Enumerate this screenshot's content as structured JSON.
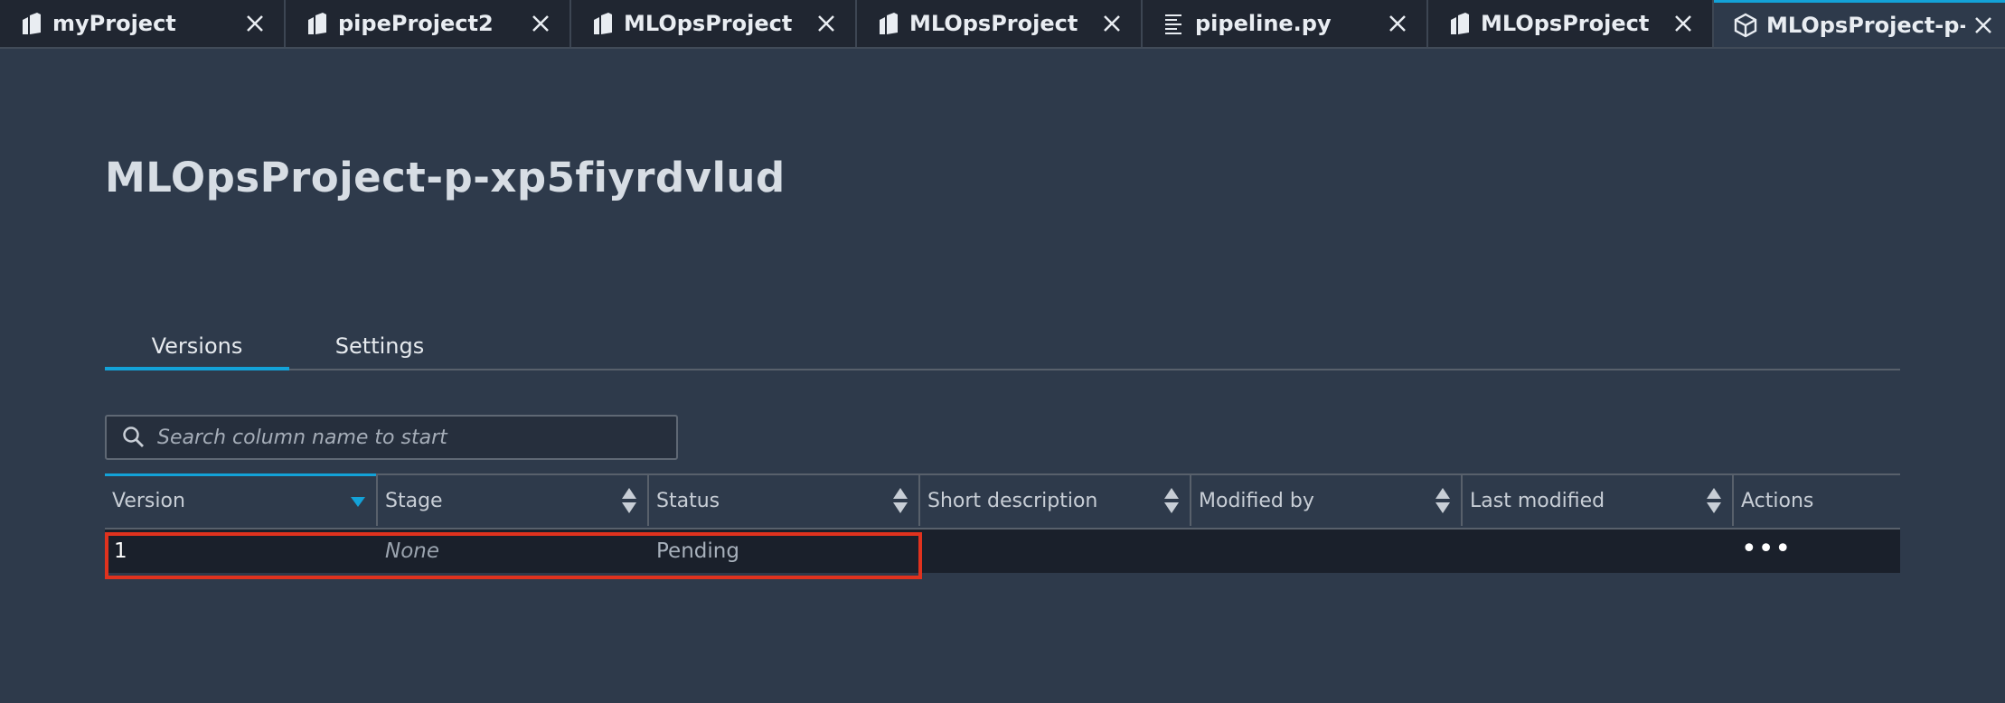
{
  "tabs": [
    {
      "label": "myProject",
      "icon": "project-icon",
      "active": false
    },
    {
      "label": "pipeProject2",
      "icon": "project-icon",
      "active": false
    },
    {
      "label": "MLOpsProject",
      "icon": "project-icon",
      "active": false
    },
    {
      "label": "MLOpsProject",
      "icon": "project-icon",
      "active": false
    },
    {
      "label": "pipeline.py",
      "icon": "file-text-icon",
      "active": false
    },
    {
      "label": "MLOpsProject",
      "icon": "project-icon",
      "active": false
    },
    {
      "label": "MLOpsProject-p-xp",
      "icon": "package-icon",
      "active": true
    }
  ],
  "page": {
    "title": "MLOpsProject-p-xp5fiyrdvlud"
  },
  "subtabs": [
    {
      "label": "Versions",
      "active": true
    },
    {
      "label": "Settings",
      "active": false
    }
  ],
  "search": {
    "placeholder": "Search column name to start",
    "value": ""
  },
  "table": {
    "columns": [
      "Version",
      "Stage",
      "Status",
      "Short description",
      "Modified by",
      "Last modified",
      "Actions"
    ],
    "rows": [
      {
        "version": "1",
        "stage": "None",
        "status": "Pending",
        "short_description": "",
        "modified_by": "",
        "last_modified": "",
        "actions": "•••"
      }
    ]
  },
  "colors": {
    "accent": "#13a2d8",
    "highlight": "#e0321e",
    "background": "#2e3a4b"
  }
}
